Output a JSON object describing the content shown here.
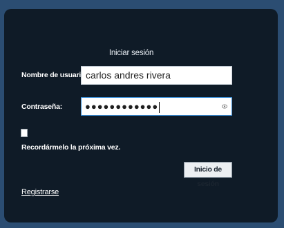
{
  "login": {
    "title": "Iniciar sesión",
    "username_label": "Nombre de usuario:",
    "username_value": "carlos andres rivera",
    "password_label": "Contraseña:",
    "password_mask": "●●●●●●●●●●●●",
    "remember_checked": false,
    "remember_label": "Recordármelo la próxima vez.",
    "login_button": "Inicio de sesión",
    "register_link": "Registrarse"
  },
  "icons": {
    "password_reveal": "eye-icon"
  },
  "colors": {
    "background": "#2b4d72",
    "panel": "#0f1b27",
    "focus_border": "#3a8fd8"
  }
}
